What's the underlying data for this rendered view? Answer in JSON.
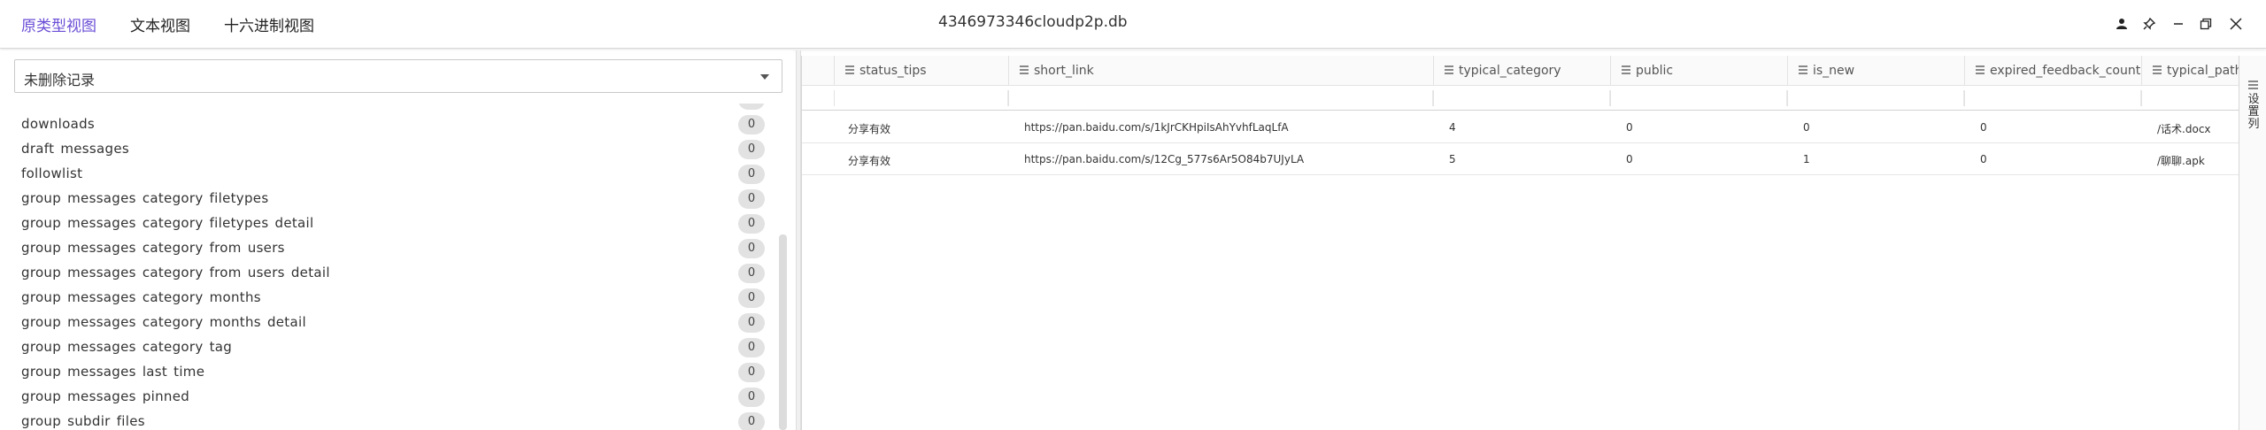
{
  "tabs": [
    "原类型视图",
    "文本视图",
    "十六进制视图"
  ],
  "title": "4346973346cloudp2p.db",
  "window_controls": [
    "user-icon",
    "pin-icon",
    "minimize-icon",
    "restore-icon",
    "close-icon"
  ],
  "accent_color": "#6a4dd6",
  "filter_select": {
    "value": "未删除记录"
  },
  "table_list": [
    {
      "name": "downloads",
      "count": "0"
    },
    {
      "name": "draft messages",
      "count": "0"
    },
    {
      "name": "followlist",
      "count": "0"
    },
    {
      "name": "group messages category filetypes",
      "count": "0"
    },
    {
      "name": "group messages category filetypes detail",
      "count": "0"
    },
    {
      "name": "group messages category from users",
      "count": "0"
    },
    {
      "name": "group messages category from users detail",
      "count": "0"
    },
    {
      "name": "group messages category months",
      "count": "0"
    },
    {
      "name": "group messages category months detail",
      "count": "0"
    },
    {
      "name": "group messages category tag",
      "count": "0"
    },
    {
      "name": "group messages last time",
      "count": "0"
    },
    {
      "name": "group messages pinned",
      "count": "0"
    },
    {
      "name": "group subdir files",
      "count": "0"
    }
  ],
  "grid": {
    "columns": [
      "status_tips",
      "short_link",
      "typical_category",
      "public",
      "is_new",
      "expired_feedback_count",
      "typical_path"
    ],
    "rows": [
      [
        "分享有效",
        "https://pan.baidu.com/s/1kJrCKHpiIsAhYvhfLaqLfA",
        "4",
        "0",
        "0",
        "0",
        "/话术.docx"
      ],
      [
        "分享有效",
        "https://pan.baidu.com/s/12Cg_577s6Ar5O84b7UJyLA",
        "5",
        "0",
        "1",
        "0",
        "/聊聊.apk"
      ]
    ]
  },
  "sidebar_label": "设置列"
}
